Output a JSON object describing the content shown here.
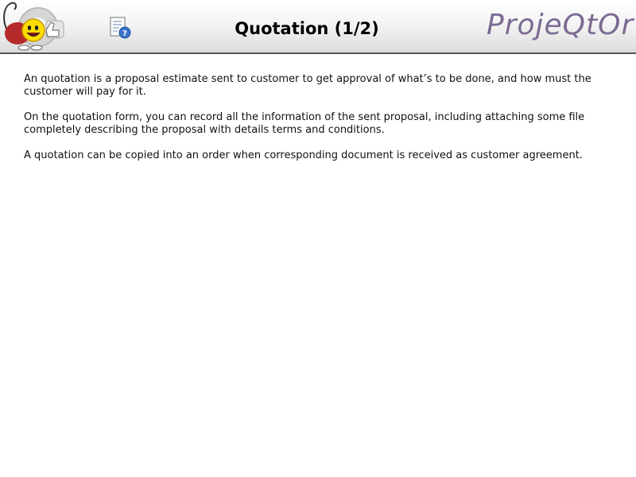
{
  "header": {
    "title": "Quotation (1/2)",
    "brand": "ProjeQtOr",
    "logo_icon": "projeqtor-mascot-logo-icon",
    "help_icon": "help-document-icon"
  },
  "content": {
    "paragraphs": [
      "An quotation is a proposal estimate sent to customer to get approval of what’s to be done, and how must the customer will pay for it.",
      "On the quotation form, you can record all the information of the sent proposal, including attaching some file completely describing the proposal with details terms and conditions.",
      "A quotation can be copied into an order when corresponding document is received as customer agreement."
    ]
  },
  "colors": {
    "brand": "#7b6b93",
    "header_border": "#555555"
  }
}
